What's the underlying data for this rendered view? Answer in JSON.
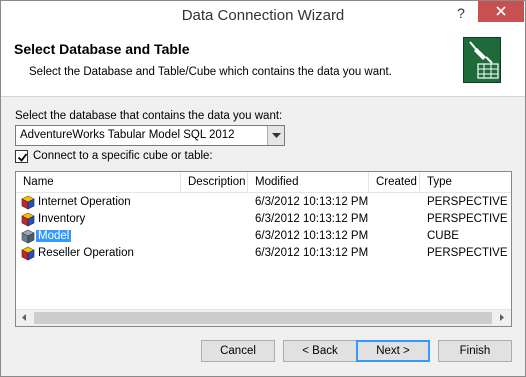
{
  "window": {
    "title": "Data Connection Wizard",
    "help_glyph": "?"
  },
  "header": {
    "title": "Select Database and Table",
    "description": "Select the Database and Table/Cube which contains the data you want."
  },
  "database": {
    "label": "Select the database that contains the data you want:",
    "selected_value": "AdventureWorks Tabular Model SQL 2012"
  },
  "connect_specific": {
    "label": "Connect to a specific cube or table:",
    "checked": true
  },
  "list": {
    "columns": [
      "Name",
      "Description",
      "Modified",
      "Created",
      "Type"
    ],
    "rows": [
      {
        "name": "Internet Operation",
        "description": "",
        "modified": "6/3/2012 10:13:12 PM",
        "created": "",
        "type": "PERSPECTIVE",
        "icon": "perspective-icon"
      },
      {
        "name": "Inventory",
        "description": "",
        "modified": "6/3/2012 10:13:12 PM",
        "created": "",
        "type": "PERSPECTIVE",
        "icon": "perspective-icon"
      },
      {
        "name": "Model",
        "description": "",
        "modified": "6/3/2012 10:13:12 PM",
        "created": "",
        "type": "CUBE",
        "icon": "cube-icon",
        "selected": true
      },
      {
        "name": "Reseller Operation",
        "description": "",
        "modified": "6/3/2012 10:13:12 PM",
        "created": "",
        "type": "PERSPECTIVE",
        "icon": "perspective-icon"
      }
    ]
  },
  "buttons": {
    "cancel": "Cancel",
    "back": "< Back",
    "next": "Next >",
    "finish": "Finish"
  },
  "colors": {
    "selection": "#3399ff",
    "close_button": "#c75050",
    "wizard_icon": "#1e6a3a"
  }
}
